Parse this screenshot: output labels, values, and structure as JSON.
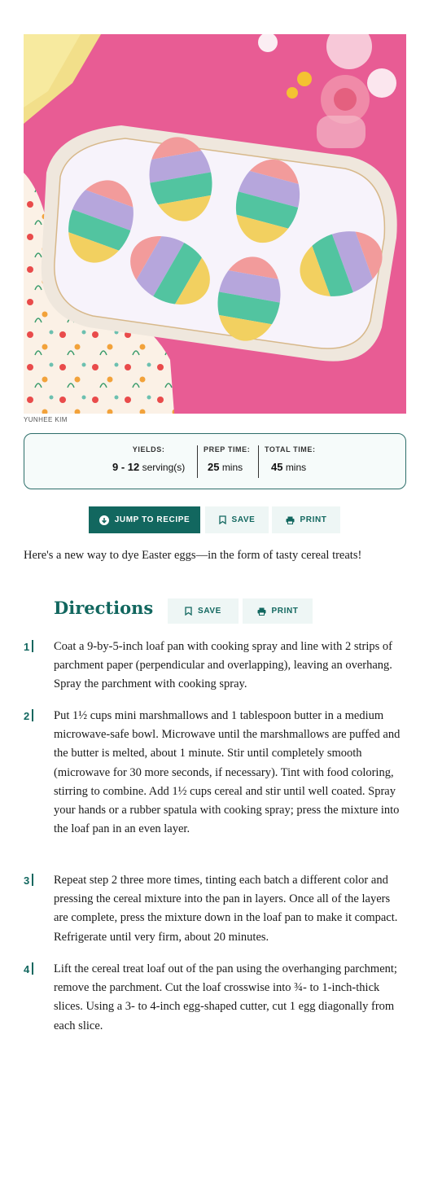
{
  "photo": {
    "alt_subject": "egg-shaped rainbow cereal treats on a platter",
    "credit": "YUNHEE KIM",
    "colors": {
      "background": "#e85c94",
      "platter": "#f4f1ee",
      "pink": "#f29b9b",
      "lavender": "#b6a6dc",
      "green": "#52c4a0",
      "yellow": "#f2d060"
    }
  },
  "stats": {
    "yields_label": "YIELDS:",
    "yields_value": "9 - 12",
    "yields_unit": "serving(s)",
    "prep_label": "PREP TIME:",
    "prep_value": "25",
    "prep_unit": "mins",
    "total_label": "TOTAL TIME:",
    "total_value": "45",
    "total_unit": "mins"
  },
  "actions": {
    "jump_label": "JUMP TO RECIPE",
    "save_label": "SAVE",
    "print_label": "PRINT"
  },
  "intro": "Here's a new way to dye Easter eggs—in the form of tasty cereal treats!",
  "directions": {
    "title": "Directions",
    "save_label": "SAVE",
    "print_label": "PRINT",
    "steps": [
      {
        "number": "1",
        "text": "Coat a 9-by-5-inch loaf pan with cooking spray and line with 2 strips of parchment paper (perpendicular and overlapping), leaving an overhang. Spray the parchment with cooking spray."
      },
      {
        "number": "2",
        "text": "Put 1½ cups mini marshmallows and 1 tablespoon butter in a medium microwave-safe bowl. Microwave until the marshmallows are puffed and the butter is melted, about 1 minute. Stir until completely smooth (microwave for 30 more seconds, if necessary). Tint with food coloring, stirring to combine. Add 1½ cups cereal and stir until well coated. Spray your hands or a rubber spatula with cooking spray; press the mixture into the loaf pan in an even layer."
      },
      {
        "number": "3",
        "text": "Repeat step 2 three more times, tinting each batch a different color and pressing the cereal mixture into the pan in layers. Once all of the layers are complete, press the mixture down in the loaf pan to make it compact. Refrigerate until very firm, about 20 minutes."
      },
      {
        "number": "4",
        "text": "Lift the cereal treat loaf out of the pan using the overhanging parchment; remove the parchment. Cut the loaf crosswise into ¾- to 1-inch-thick slices. Using a 3- to 4-inch egg-shaped cutter, cut 1 egg diagonally from each slice."
      }
    ]
  },
  "theme": {
    "accent": "#12675f",
    "accent_light": "#eef6f5"
  }
}
